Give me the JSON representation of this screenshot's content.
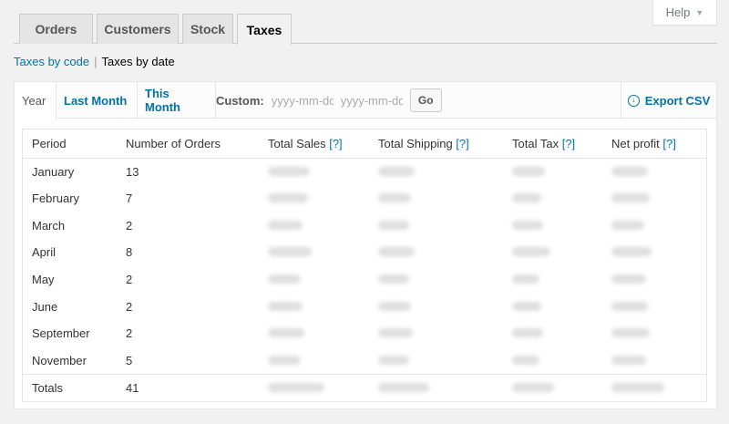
{
  "help": {
    "label": "Help"
  },
  "nav_tabs": [
    {
      "label": "Orders"
    },
    {
      "label": "Customers"
    },
    {
      "label": "Stock"
    },
    {
      "label": "Taxes"
    }
  ],
  "subnav": {
    "taxes_by_code": "Taxes by code",
    "separator": "|",
    "taxes_by_date": "Taxes by date"
  },
  "range_tabs": [
    {
      "label": "Year"
    },
    {
      "label": "Last Month"
    },
    {
      "label": "This Month"
    }
  ],
  "custom": {
    "label": "Custom:",
    "start_placeholder": "yyyy-mm-dd",
    "end_placeholder": "yyyy-mm-dd",
    "go_label": "Go"
  },
  "export": {
    "label": "Export CSV"
  },
  "table": {
    "headers": {
      "period": "Period",
      "orders": "Number of Orders",
      "sales": "Total Sales",
      "shipping": "Total Shipping",
      "tax": "Total Tax",
      "profit": "Net profit",
      "help_marker": "[?]"
    },
    "rows": [
      {
        "period": "January",
        "orders": "13"
      },
      {
        "period": "February",
        "orders": "7"
      },
      {
        "period": "March",
        "orders": "2"
      },
      {
        "period": "April",
        "orders": "8"
      },
      {
        "period": "May",
        "orders": "2"
      },
      {
        "period": "June",
        "orders": "2"
      },
      {
        "period": "September",
        "orders": "2"
      },
      {
        "period": "November",
        "orders": "5"
      }
    ],
    "totals": {
      "label": "Totals",
      "orders": "41"
    }
  }
}
